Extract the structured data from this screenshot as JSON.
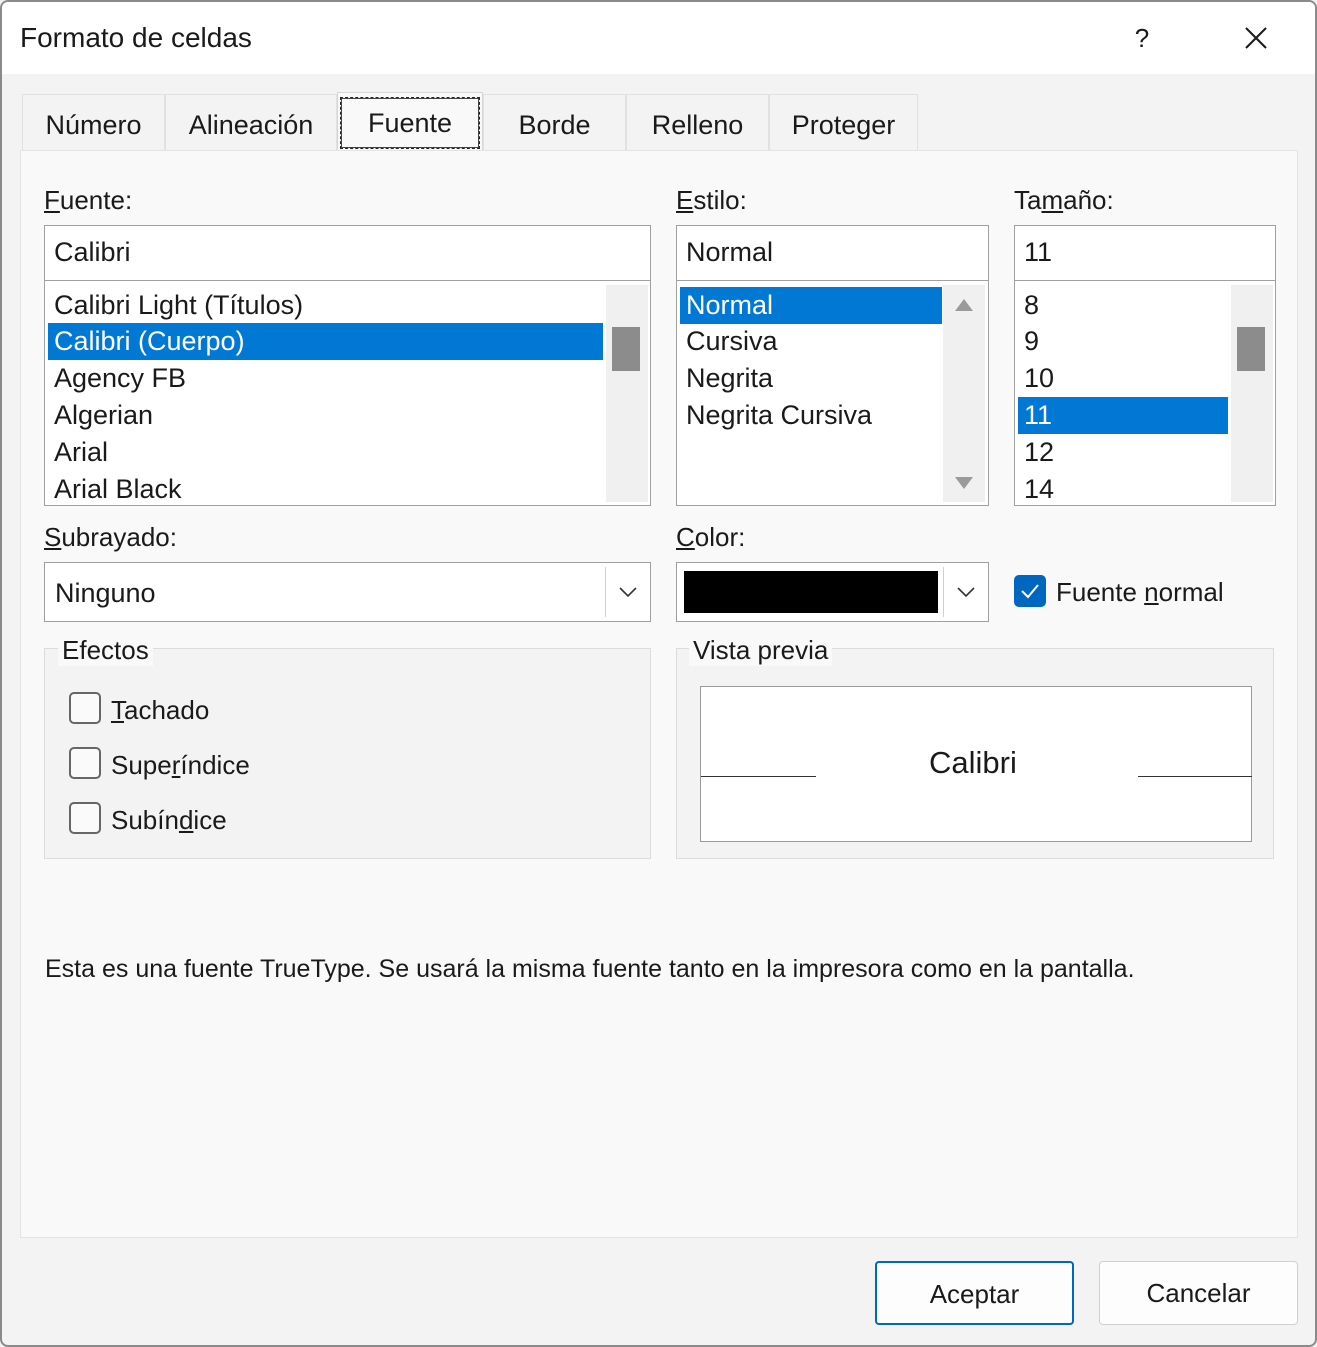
{
  "window": {
    "title": "Formato de celdas",
    "help_label": "?"
  },
  "tabs": [
    {
      "label": "Número"
    },
    {
      "label": "Alineación"
    },
    {
      "label": "Fuente"
    },
    {
      "label": "Borde"
    },
    {
      "label": "Relleno"
    },
    {
      "label": "Proteger"
    }
  ],
  "active_tab": "Fuente",
  "font": {
    "label_underlined": "F",
    "label_rest": "uente:",
    "value": "Calibri",
    "items": [
      "Calibri Light (Títulos)",
      "Calibri (Cuerpo)",
      "Agency FB",
      "Algerian",
      "Arial",
      "Arial Black"
    ],
    "selected": "Calibri (Cuerpo)"
  },
  "style": {
    "label_underlined": "E",
    "label_rest": "stilo:",
    "value": "Normal",
    "items": [
      "Normal",
      "Cursiva",
      "Negrita",
      "Negrita Cursiva"
    ],
    "selected": "Normal"
  },
  "size": {
    "label_before": "Ta",
    "label_underlined": "m",
    "label_after": "año:",
    "value": "11",
    "items": [
      "8",
      "9",
      "10",
      "11",
      "12",
      "14"
    ],
    "selected": "11"
  },
  "underline": {
    "label_underlined": "S",
    "label_rest": "ubrayado:",
    "value": "Ninguno"
  },
  "color": {
    "label_underlined": "C",
    "label_rest": "olor:",
    "swatch": "#000000"
  },
  "normal_font": {
    "label_before": "Fuente ",
    "label_underlined": "n",
    "label_after": "ormal",
    "checked": true
  },
  "effects": {
    "title": "Efectos",
    "strikethrough": {
      "label_underlined": "T",
      "label_rest": "achado",
      "checked": false
    },
    "superscript": {
      "label_before": "Supe",
      "label_underlined": "r",
      "label_after": "índice",
      "checked": false
    },
    "subscript": {
      "label_before": "Subín",
      "label_underlined": "d",
      "label_after": "ice",
      "checked": false
    }
  },
  "preview": {
    "title": "Vista previa",
    "text": "Calibri"
  },
  "info_text": "Esta es una fuente TrueType. Se usará la misma fuente tanto en la impresora como en la pantalla.",
  "buttons": {
    "ok": "Aceptar",
    "cancel": "Cancelar"
  },
  "colors": {
    "selection": "#0078d4",
    "accent": "#0067c0"
  }
}
